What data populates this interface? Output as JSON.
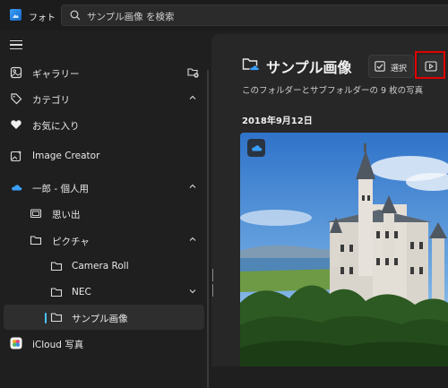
{
  "app": {
    "title": "フォト",
    "logo": "photos-app-icon"
  },
  "search": {
    "placeholder": "サンプル画像 を検索"
  },
  "sidebar": {
    "items": [
      {
        "label": "ギャラリー",
        "icon": "gallery-icon",
        "trailing": "add-folder-icon"
      },
      {
        "label": "カテゴリ",
        "icon": "tag-icon",
        "trailing": "chevron-up"
      },
      {
        "label": "お気に入り",
        "icon": "heart-icon"
      },
      {
        "label": "Image Creator",
        "icon": "image-creator-icon"
      },
      {
        "label": "一郎 - 個人用",
        "icon": "onedrive-cloud-icon",
        "trailing": "chevron-up"
      },
      {
        "label": "思い出",
        "icon": "memories-icon"
      },
      {
        "label": "ピクチャ",
        "icon": "folder-icon",
        "trailing": "chevron-up"
      },
      {
        "label": "Camera Roll",
        "icon": "folder-icon"
      },
      {
        "label": "NEC",
        "icon": "folder-icon",
        "trailing": "chevron-down"
      },
      {
        "label": "サンプル画像",
        "icon": "folder-icon",
        "selected": true
      },
      {
        "label": "iCloud 写真",
        "icon": "icloud-icon"
      }
    ]
  },
  "main": {
    "title": "サンプル画像",
    "subtitle": "このフォルダーとサブフォルダーの 9 枚の写真",
    "select_label": "選択",
    "date_header": "2018年9月12日"
  },
  "colors": {
    "accent": "#4cc2ff",
    "highlight": "#e10000",
    "background": "#1f1f1f"
  }
}
